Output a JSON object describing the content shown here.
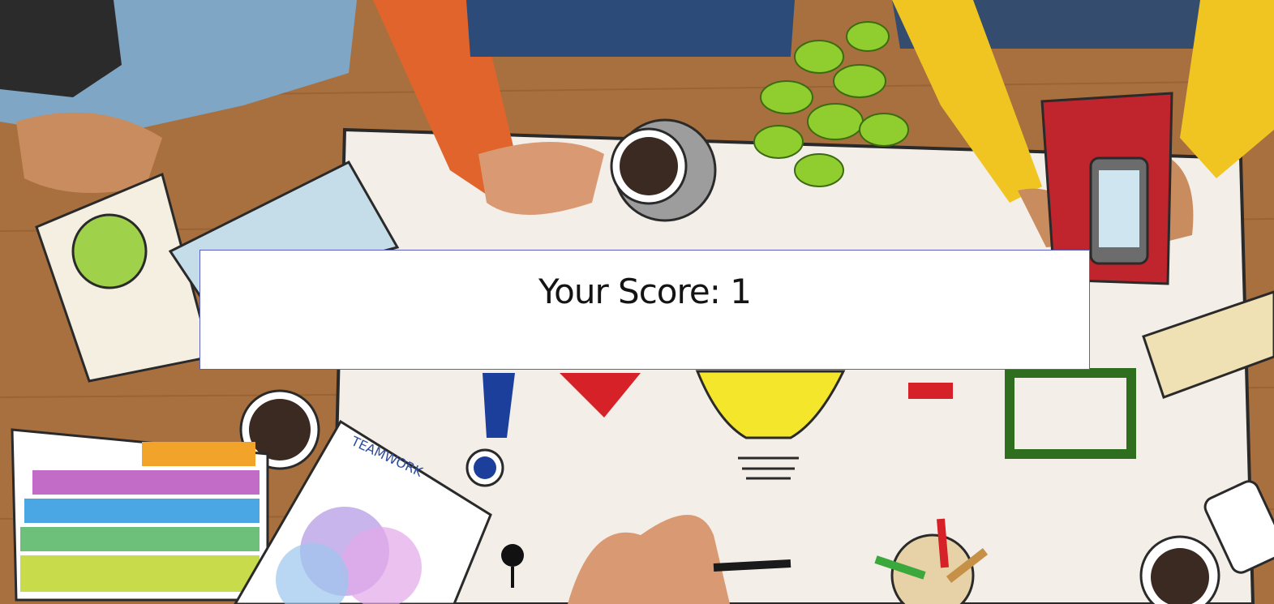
{
  "score": {
    "label": "Your Score:",
    "value": "1"
  },
  "background": {
    "poster_text": "TEAMWORK"
  },
  "colors": {
    "table_wood": "#a9703f",
    "paper": "#f3efe8",
    "panel_bg": "#ffffff",
    "panel_border": "#5a5fc2",
    "text": "#141414"
  }
}
